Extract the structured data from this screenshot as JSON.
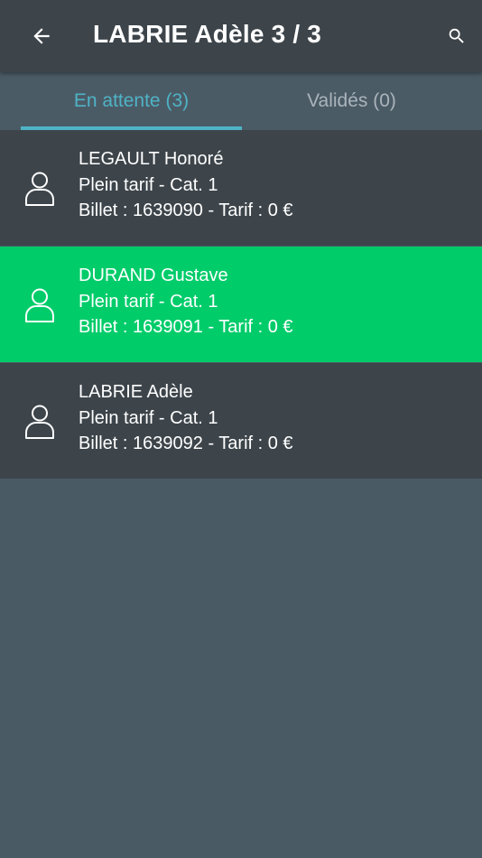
{
  "header": {
    "title": "LABRIE Adèle 3 / 3",
    "back_icon": "arrow-left-icon",
    "search_icon": "search-icon"
  },
  "tabs": [
    {
      "label": "En attente (3)",
      "active": true
    },
    {
      "label": "Validés (0)",
      "active": false
    }
  ],
  "passengers": [
    {
      "name": "LEGAULT Honoré",
      "tariff": "Plein tarif - Cat. 1",
      "ticket": "Billet : 1639090 - Tarif : 0 €",
      "selected": false
    },
    {
      "name": "DURAND Gustave",
      "tariff": "Plein tarif - Cat. 1",
      "ticket": "Billet : 1639091 - Tarif : 0 €",
      "selected": true
    },
    {
      "name": "LABRIE Adèle",
      "tariff": "Plein tarif - Cat. 1",
      "ticket": "Billet : 1639092 - Tarif : 0 €",
      "selected": false
    }
  ],
  "colors": {
    "toolbar": "#3d454b",
    "background": "#4a5a65",
    "accent": "#4fb3c6",
    "selected_row": "#00cc6a"
  }
}
